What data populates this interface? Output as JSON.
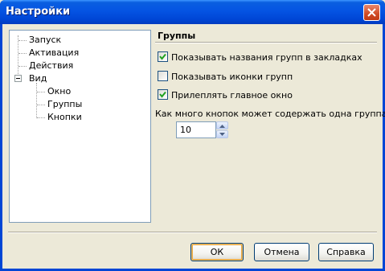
{
  "window": {
    "title": "Настройки",
    "close_icon": "close-icon"
  },
  "tree": {
    "items": [
      {
        "label": "Запуск"
      },
      {
        "label": "Активация"
      },
      {
        "label": "Действия"
      },
      {
        "label": "Вид",
        "expanded": true
      },
      {
        "label": "Окно"
      },
      {
        "label": "Группы"
      },
      {
        "label": "Кнопки"
      }
    ]
  },
  "panel": {
    "title": "Группы",
    "options": [
      {
        "label": "Показывать названия групп в закладках",
        "checked": true
      },
      {
        "label": "Показывать иконки групп",
        "checked": false
      },
      {
        "label": "Прилеплять главное окно",
        "checked": true
      }
    ],
    "question": "Как много кнопок может содержать одна группа?",
    "spin_value": "10"
  },
  "buttons": {
    "ok": "ОК",
    "cancel": "Отмена",
    "help": "Справка"
  },
  "colors": {
    "title_bar": "#0554e3",
    "close": "#d14b24",
    "checkbox_mark": "#21a121"
  }
}
